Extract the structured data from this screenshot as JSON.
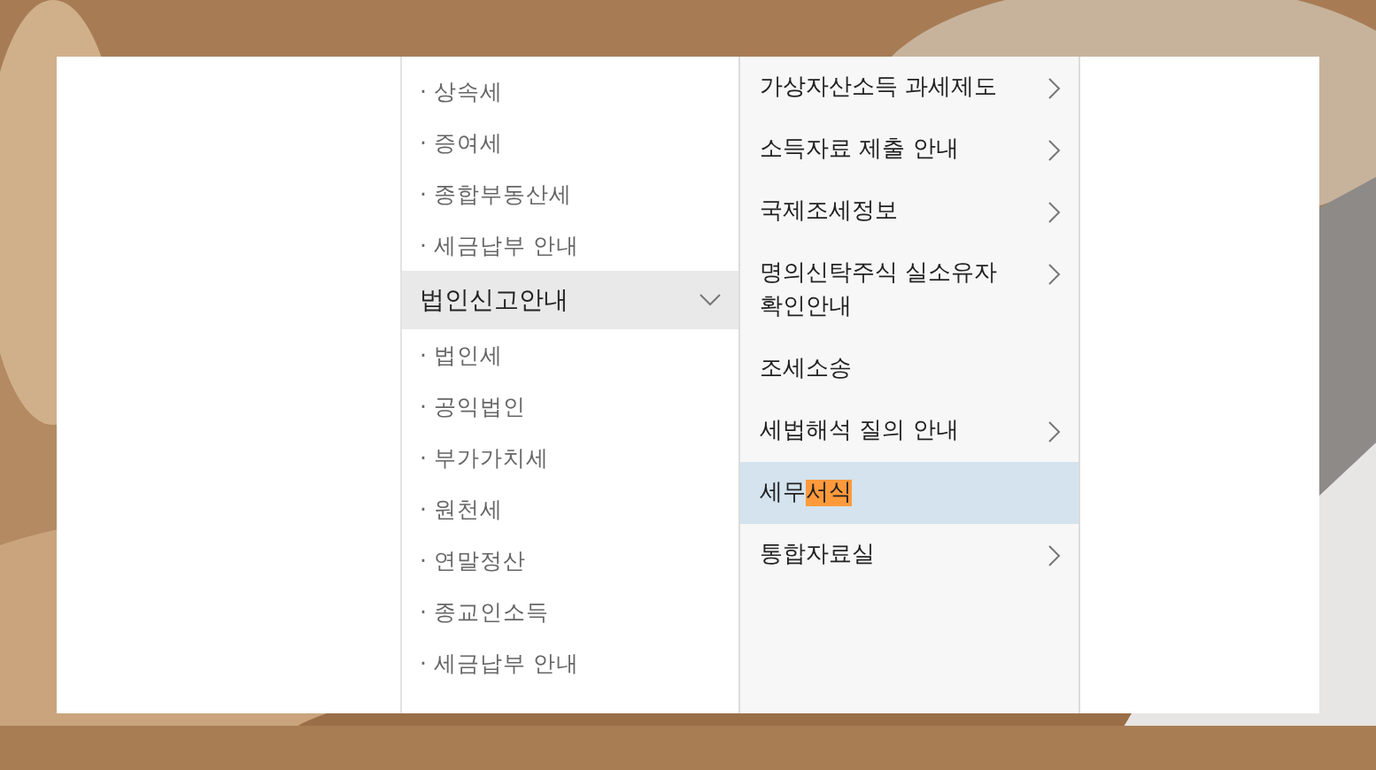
{
  "menu": {
    "items": [
      {
        "kind": "sub",
        "label": "· 상속세"
      },
      {
        "kind": "sub",
        "label": "· 증여세"
      },
      {
        "kind": "sub",
        "label": "· 종합부동산세"
      },
      {
        "kind": "sub",
        "label": "· 세금납부 안내"
      },
      {
        "kind": "header",
        "label": "법인신고안내",
        "expanded": true
      },
      {
        "kind": "sub",
        "label": "· 법인세"
      },
      {
        "kind": "sub",
        "label": "· 공익법인"
      },
      {
        "kind": "sub",
        "label": "· 부가가치세"
      },
      {
        "kind": "sub",
        "label": "· 원천세"
      },
      {
        "kind": "sub",
        "label": "· 연말정산"
      },
      {
        "kind": "sub",
        "label": "· 종교인소득"
      },
      {
        "kind": "sub",
        "label": "· 세금납부 안내"
      }
    ]
  },
  "submenu": {
    "items": [
      {
        "parts": [
          {
            "text": "가상자산소득 과세제도",
            "highlighted": false
          }
        ],
        "has_submenu": true,
        "selected": false
      },
      {
        "parts": [
          {
            "text": "소득자료 제출 안내",
            "highlighted": false
          }
        ],
        "has_submenu": true,
        "selected": false
      },
      {
        "parts": [
          {
            "text": "국제조세정보",
            "highlighted": false
          }
        ],
        "has_submenu": true,
        "selected": false
      },
      {
        "parts": [
          {
            "text": "명의신탁주식 실소유자 확인안내",
            "highlighted": false
          }
        ],
        "has_submenu": true,
        "selected": false
      },
      {
        "parts": [
          {
            "text": "조세소송",
            "highlighted": false
          }
        ],
        "has_submenu": false,
        "selected": false
      },
      {
        "parts": [
          {
            "text": "세법해석 질의 안내",
            "highlighted": false
          }
        ],
        "has_submenu": true,
        "selected": false
      },
      {
        "parts": [
          {
            "text": "세무",
            "highlighted": false
          },
          {
            "text": "서식",
            "highlighted": true
          }
        ],
        "has_submenu": false,
        "selected": true
      },
      {
        "parts": [
          {
            "text": "통합자료실",
            "highlighted": false
          }
        ],
        "has_submenu": true,
        "selected": false
      }
    ]
  }
}
